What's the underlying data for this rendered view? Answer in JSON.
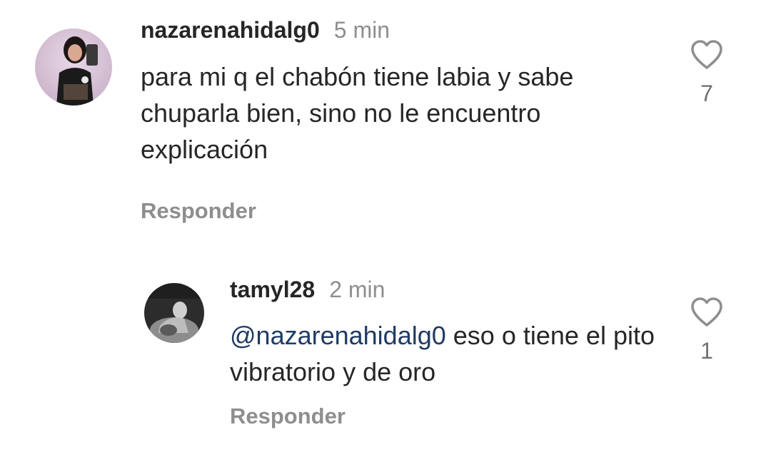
{
  "comments": [
    {
      "username": "nazarenahidalg0",
      "time": "5 min",
      "text": "para mi q el chabón tiene labia y sabe chuparla bien, sino no le encuentro explicación",
      "reply_label": "Responder",
      "like_count": "7",
      "avatar_icon": "profile-photo-woman-selfie",
      "like_icon": "heart-outline-icon"
    },
    {
      "username": "tamyl28",
      "time": "2 min",
      "mention": "@nazarenahidalg0",
      "text": "eso o tiene el pito vibratorio y de oro",
      "reply_label": "Responder",
      "like_count": "1",
      "avatar_icon": "profile-photo-bw",
      "like_icon": "heart-outline-icon"
    }
  ],
  "colors": {
    "text": "#262626",
    "muted": "#8e8e8e",
    "mention": "#1f3b63",
    "background": "#ffffff"
  }
}
